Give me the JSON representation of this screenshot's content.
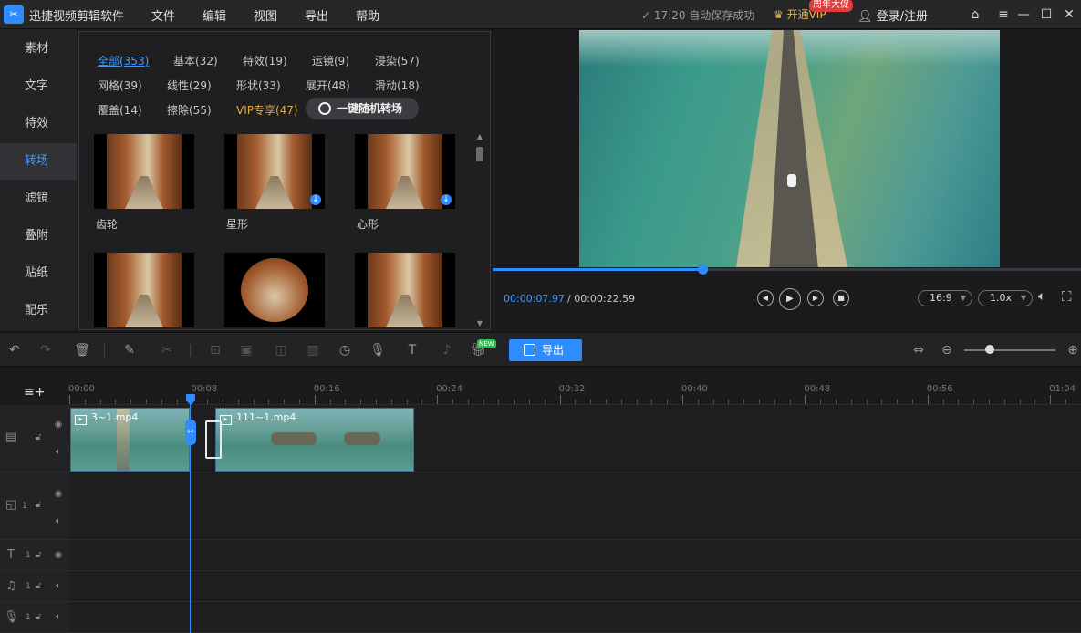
{
  "titlebar": {
    "app_title": "迅捷视频剪辑软件",
    "menus": [
      "文件",
      "编辑",
      "视图",
      "导出",
      "帮助"
    ],
    "autosave": "✓ 17:20 自动保存成功",
    "vip_label": "开通VIP",
    "vip_badge": "周年大促",
    "login_label": "登录/注册"
  },
  "leftnav": {
    "items": [
      "素材",
      "文字",
      "特效",
      "转场",
      "滤镜",
      "叠附",
      "贴纸",
      "配乐"
    ],
    "active_index": 3
  },
  "library": {
    "categories": [
      {
        "label": "全部(353)",
        "active": true
      },
      {
        "label": "基本(32)"
      },
      {
        "label": "特效(19)"
      },
      {
        "label": "运镜(9)"
      },
      {
        "label": "浸染(57)"
      },
      {
        "label": "网格(39)"
      },
      {
        "label": "线性(29)"
      },
      {
        "label": "形状(33)"
      },
      {
        "label": "展开(48)"
      },
      {
        "label": "滑动(18)"
      },
      {
        "label": "覆盖(14)"
      },
      {
        "label": "擦除(55)"
      },
      {
        "label": "VIP专享(47)",
        "vip": true
      }
    ],
    "random_button": "一键随机转场",
    "tiles": [
      {
        "label": "齿轮",
        "downloadable": false
      },
      {
        "label": "星形",
        "downloadable": true
      },
      {
        "label": "心形",
        "downloadable": true
      },
      {
        "label": "",
        "downloadable": false
      },
      {
        "label": "",
        "downloadable": false
      },
      {
        "label": "",
        "downloadable": false
      }
    ]
  },
  "preview": {
    "current_time": "00:00:07.97",
    "total_time": "/ 00:00:22.59",
    "progress": 0.357,
    "aspect_ratio": "16:9",
    "speed": "1.0x"
  },
  "toolbar": {
    "new_badge": "NEW",
    "export_label": "导出",
    "zoom_level": 0.28
  },
  "timeline": {
    "ruler_labels": [
      "00:00",
      "00:08",
      "00:16",
      "00:24",
      "00:32",
      "00:40",
      "00:48",
      "00:56",
      "01:04"
    ],
    "clips": [
      {
        "name": "3~1.mp4"
      },
      {
        "name": "111~1.mp4"
      }
    ],
    "track_numbers": [
      "1",
      "1",
      "1",
      "1"
    ]
  },
  "colors": {
    "accent": "#2f8cff",
    "vip": "#e8a93a",
    "badge_red": "#e23b3b",
    "badge_green": "#2ebd4f"
  }
}
